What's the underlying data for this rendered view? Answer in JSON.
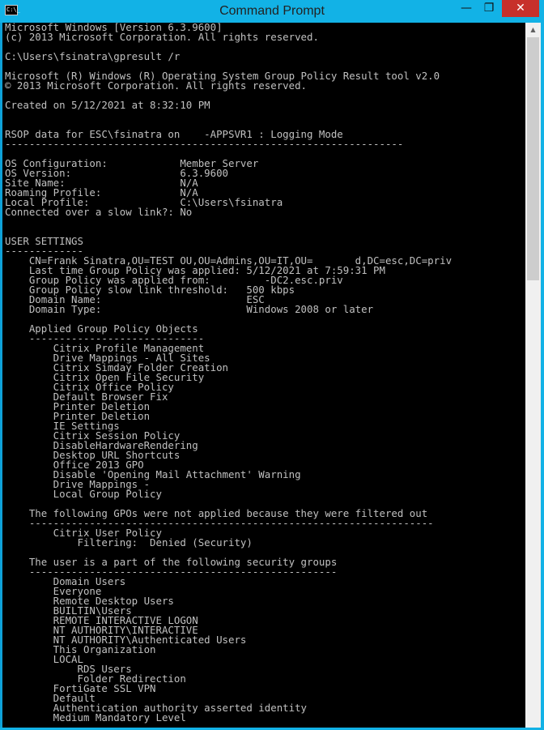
{
  "window": {
    "title": "Command Prompt",
    "buttons": {
      "minimize": "—",
      "maximize": "❐",
      "close": "✕"
    }
  },
  "console": {
    "lines": [
      "Microsoft Windows [Version 6.3.9600]",
      "(c) 2013 Microsoft Corporation. All rights reserved.",
      "",
      "C:\\Users\\fsinatra\\gpresult /r",
      "",
      "Microsoft (R) Windows (R) Operating System Group Policy Result tool v2.0",
      "© 2013 Microsoft Corporation. All rights reserved.",
      "",
      "Created on 5/12/2021 at 8:32:10 PM",
      "",
      "",
      "RSOP data for ESC\\fsinatra on    -APPSVR1 : Logging Mode",
      "------------------------------------------------------------------",
      "",
      "OS Configuration:            Member Server",
      "OS Version:                  6.3.9600",
      "Site Name:                   N/A",
      "Roaming Profile:             N/A",
      "Local Profile:               C:\\Users\\fsinatra",
      "Connected over a slow link?: No",
      "",
      "",
      "USER SETTINGS",
      "-------------",
      "    CN=Frank Sinatra,OU=TEST OU,OU=Admins,OU=IT,OU=       d,DC=esc,DC=priv",
      "    Last time Group Policy was applied: 5/12/2021 at 7:59:31 PM",
      "    Group Policy was applied from:         -DC2.esc.priv",
      "    Group Policy slow link threshold:   500 kbps",
      "    Domain Name:                        ESC",
      "    Domain Type:                        Windows 2008 or later",
      "",
      "    Applied Group Policy Objects",
      "    -----------------------------",
      "        Citrix Profile Management",
      "        Drive Mappings - All Sites",
      "        Citrix Simday Folder Creation",
      "        Citrix Open File Security",
      "        Citrix Office Policy",
      "        Default Browser Fix",
      "        Printer Deletion",
      "        Printer Deletion",
      "        IE Settings",
      "        Citrix Session Policy",
      "        DisableHardwareRendering",
      "        Desktop URL Shortcuts",
      "        Office 2013 GPO",
      "        Disable 'Opening Mail Attachment' Warning",
      "        Drive Mappings -",
      "        Local Group Policy",
      "",
      "    The following GPOs were not applied because they were filtered out",
      "    -------------------------------------------------------------------",
      "        Citrix User Policy",
      "            Filtering:  Denied (Security)",
      "",
      "    The user is a part of the following security groups",
      "    ---------------------------------------------------",
      "        Domain Users",
      "        Everyone",
      "        Remote Desktop Users",
      "        BUILTIN\\Users",
      "        REMOTE INTERACTIVE LOGON",
      "        NT AUTHORITY\\INTERACTIVE",
      "        NT AUTHORITY\\Authenticated Users",
      "        This Organization",
      "        LOCAL",
      "            RDS Users",
      "            Folder Redirection",
      "        FortiGate SSL VPN",
      "        Default",
      "        Authentication authority asserted identity",
      "        Medium Mandatory Level"
    ]
  }
}
